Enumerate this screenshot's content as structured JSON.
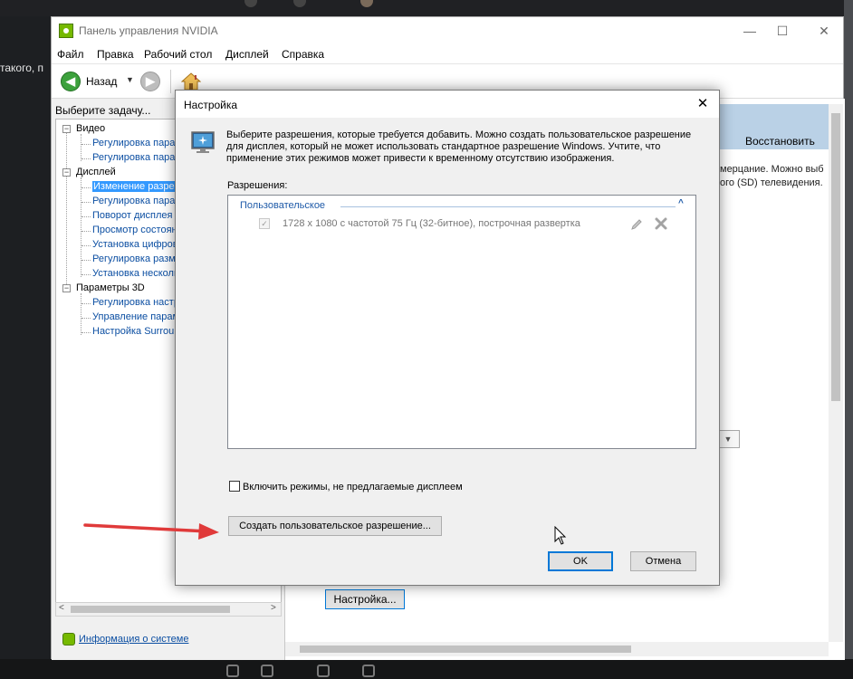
{
  "background": {
    "left_text": "такого, п"
  },
  "window": {
    "title": "Панель управления NVIDIA",
    "controls": {
      "minimize": "—",
      "maximize": "☐",
      "close": "✕"
    }
  },
  "menu": [
    "Файл",
    "Правка",
    "Рабочий стол",
    "Дисплей",
    "Справка"
  ],
  "toolbar": {
    "back_label": "Назад",
    "back_icon": "arrow-left-icon",
    "forward_icon": "arrow-right-icon",
    "home_icon": "home-icon"
  },
  "left_panel": {
    "task_label": "Выберите задачу...",
    "tree": [
      {
        "label": "Видео",
        "type": "group"
      },
      {
        "label": "Регулировка пара",
        "type": "leaf"
      },
      {
        "label": "Регулировка пара",
        "type": "leaf"
      },
      {
        "label": "Дисплей",
        "type": "group"
      },
      {
        "label": "Изменение разреш",
        "type": "leaf",
        "selected": true
      },
      {
        "label": "Регулировка пара",
        "type": "leaf"
      },
      {
        "label": "Поворот дисплея",
        "type": "leaf"
      },
      {
        "label": "Просмотр состоян",
        "type": "leaf"
      },
      {
        "label": "Установка цифров",
        "type": "leaf"
      },
      {
        "label": "Регулировка разм",
        "type": "leaf"
      },
      {
        "label": "Установка несколь",
        "type": "leaf"
      },
      {
        "label": "Параметры 3D",
        "type": "group"
      },
      {
        "label": "Регулировка настр",
        "type": "leaf"
      },
      {
        "label": "Управление парам",
        "type": "leaf"
      },
      {
        "label": "Настройка Surroun",
        "type": "leaf"
      }
    ],
    "system_info_link": "Информация о системе"
  },
  "right_panel": {
    "restore_label": "Восстановить",
    "text_line_1": "мерцание. Можно выб",
    "text_line_2": "ого (SD) телевидения.",
    "settings_button": "Настройка..."
  },
  "dialog": {
    "title": "Настройка",
    "description": "Выберите разрешения, которые требуется добавить. Можно создать пользовательское разрешение для дисплея, который не может использовать стандартное разрешение Windows. Учтите, что применение этих режимов может привести к временному отсутствию изображения.",
    "resolutions_label": "Разрешения:",
    "group_header": "Пользовательское",
    "resolution_item": "1728 x 1080 с частотой 75 Гц (32-битное), построчная развертка",
    "include_modes_label": "Включить режимы, не предлагаемые дисплеем",
    "create_button": "Создать пользовательское разрешение...",
    "ok_button": "OK",
    "cancel_button": "Отмена"
  },
  "colors": {
    "nvidia_green": "#76b900",
    "selection_blue": "#3399ff",
    "accent_blue": "#0078d7",
    "link_blue": "#0b4ea2",
    "arrow_red": "#e03a3a"
  }
}
